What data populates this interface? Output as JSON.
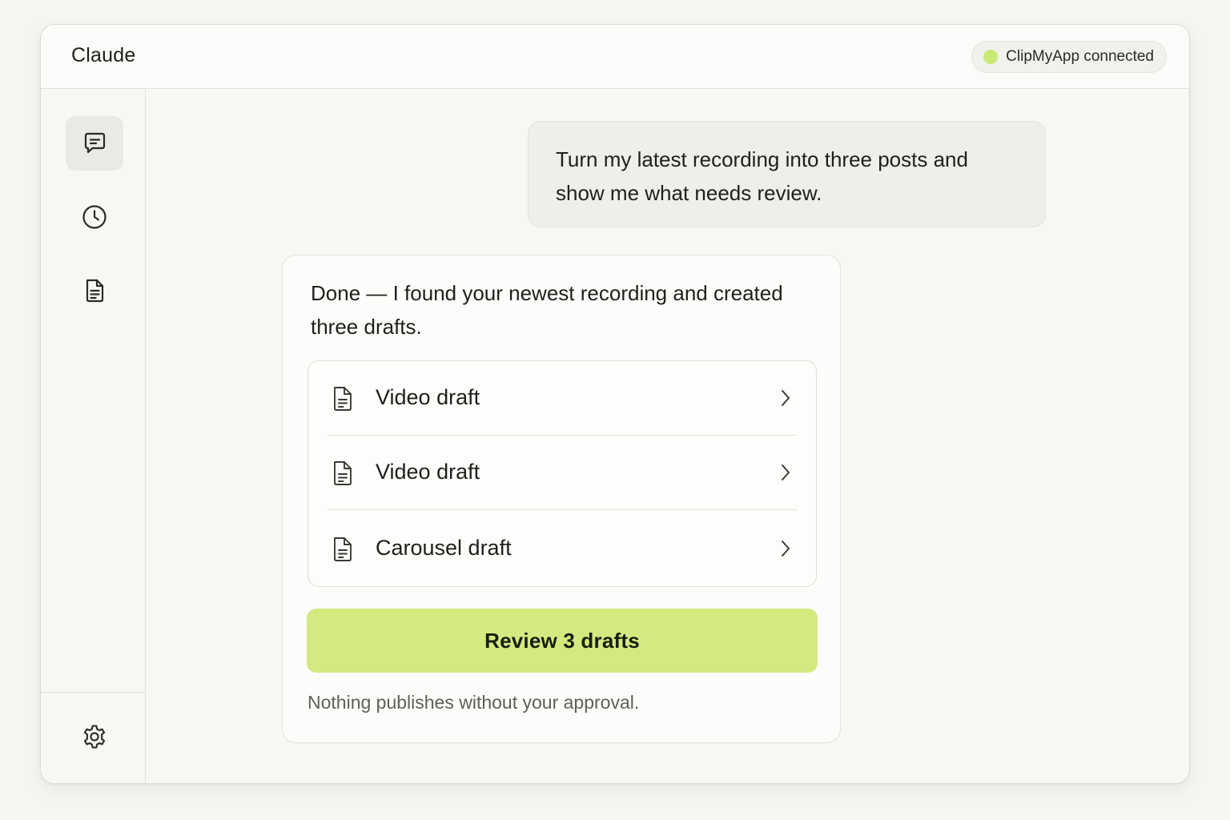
{
  "app": {
    "title": "Claude"
  },
  "connection": {
    "status_text": "ClipMyApp connected",
    "dot_color": "#c9ea74"
  },
  "sidebar": {
    "items": [
      {
        "name": "chat",
        "icon": "chat-bubble-icon",
        "active": true
      },
      {
        "name": "history",
        "icon": "clock-icon",
        "active": false
      },
      {
        "name": "documents",
        "icon": "document-icon",
        "active": false
      }
    ],
    "footer_icon": "gear-icon"
  },
  "conversation": {
    "user_message": "Turn my latest recording into three posts and show me what needs review.",
    "assistant_message": "Done — I found your newest recording and created three drafts.",
    "drafts": [
      {
        "label": "Video draft",
        "icon": "document-icon"
      },
      {
        "label": "Video draft",
        "icon": "document-icon"
      },
      {
        "label": "Carousel draft",
        "icon": "document-icon"
      }
    ],
    "review_button_label": "Review 3 drafts",
    "review_button_color": "#d4ea80",
    "approval_note": "Nothing publishes without your approval."
  }
}
